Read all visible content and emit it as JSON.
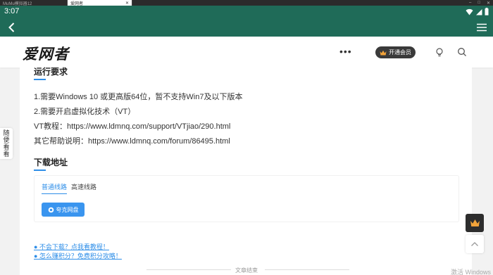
{
  "tabstrip": {
    "tabs": [
      {
        "label": "MuMu模拟器12"
      },
      {
        "label": "爱网者"
      }
    ]
  },
  "statusbar": {
    "time": "3:07"
  },
  "side_float": {
    "label": [
      "随",
      "便",
      "看",
      "看"
    ]
  },
  "site": {
    "logo": "爱网者",
    "more_dots": "•••",
    "vip_label": "开通会员"
  },
  "article": {
    "requirements_title": "运行要求",
    "requirements": [
      "1.需要Windows 10 或更高版64位，暂不支持Win7及以下版本",
      "2.需要开启虚拟化技术（VT）",
      "VT教程：https://www.ldmnq.com/support/VTjiao/290.html",
      "其它帮助说明：https://www.ldmnq.com/forum/86495.html"
    ],
    "download_title": "下载地址",
    "download_tabs": [
      "普通线路",
      "高速线路"
    ],
    "download_button": "夸克网盘",
    "help_links": [
      "● 不会下载？点我看教程！",
      "● 怎么赚积分？免费积分攻略！"
    ],
    "end_text": "文章结束"
  },
  "watermark": "激活 Windows",
  "colors": {
    "header_green": "#1f6b58",
    "accent_blue": "#2e8ee8",
    "button_blue": "#3a95ef",
    "vip_dark": "#3a3a3a"
  }
}
